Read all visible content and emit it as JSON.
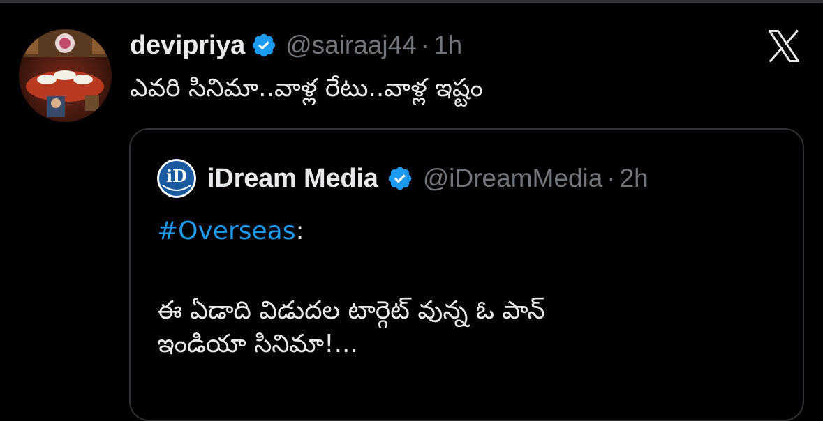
{
  "tweet": {
    "author": {
      "display_name": "devipriya",
      "handle": "@sairaaj44",
      "verified": true
    },
    "separator": "·",
    "time": "1h",
    "text": "ఎవరి సినిమా..వాళ్ల రేటు..వాళ్ల ఇష్టం"
  },
  "quoted_tweet": {
    "author": {
      "display_name": "iDream Media",
      "handle": "@iDreamMedia",
      "verified": true
    },
    "separator": "·",
    "time": "2h",
    "hashtag": "#Overseas",
    "hashtag_suffix": ":",
    "line_1": "ఈ ఏడాది విడుదల టార్గెట్ వున్న ఓ పాన్",
    "line_2": "ఇండియా సినిమా!..."
  },
  "icons": {
    "platform_logo": "x-logo-icon",
    "verified_badge": "verified-badge-icon"
  },
  "colors": {
    "background": "#000000",
    "primary_text": "#e7e9ea",
    "secondary_text": "#71767b",
    "accent": "#1d9bf0",
    "border": "#2f3336"
  }
}
